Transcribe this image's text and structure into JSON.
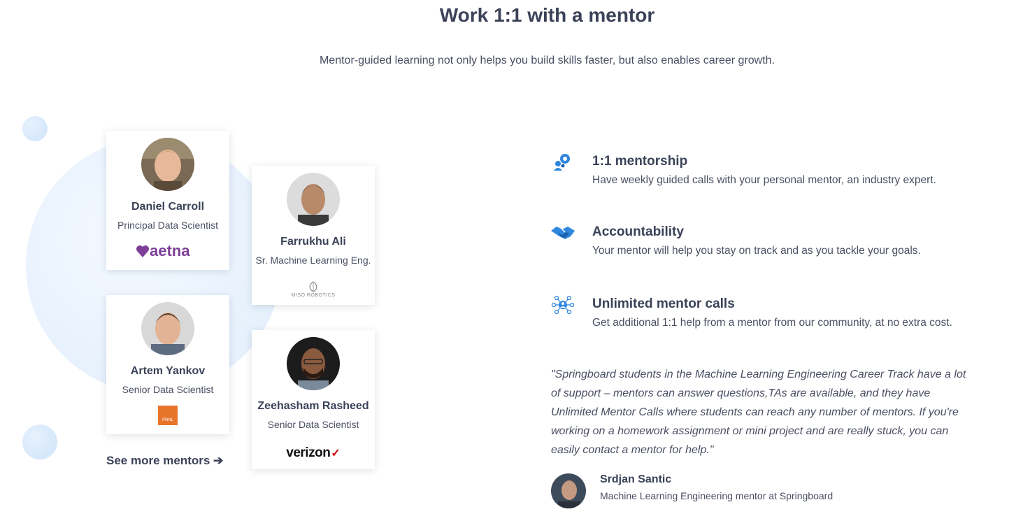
{
  "header": {
    "title": "Work 1:1 with a mentor",
    "subtitle": "Mentor-guided learning not only helps you build skills faster, but also enables career growth."
  },
  "mentors": [
    {
      "name": "Daniel Carroll",
      "role": "Principal Data Scientist",
      "company_logo": "aetna"
    },
    {
      "name": "Farrukhu Ali",
      "role": "Sr. Machine Learning Eng.",
      "company_logo": "MISO ROBOTICS"
    },
    {
      "name": "Artem Yankov",
      "role": "Senior Data Scientist",
      "company_logo": "PNNL"
    },
    {
      "name": "Zeehasham Rasheed",
      "role": "Senior Data Scientist",
      "company_logo": "verizon"
    }
  ],
  "see_more": "See more mentors ➔",
  "features": [
    {
      "icon": "mentorship-icon",
      "title": "1:1 mentorship",
      "text": "Have weekly guided calls with your personal mentor, an industry expert."
    },
    {
      "icon": "handshake-icon",
      "title": "Accountability",
      "text": "Your mentor will help you stay on track and as you tackle your goals."
    },
    {
      "icon": "network-icon",
      "title": "Unlimited mentor calls",
      "text": "Get additional 1:1 help from a mentor from our community, at no extra cost."
    }
  ],
  "testimonial": {
    "quote": "\"Springboard students in the Machine Learning Engineering Career Track have a lot of support – mentors can answer questions,TAs are available, and they have Unlimited Mentor Calls where students can reach any number of mentors. If you're working on a homework assignment or mini project and are really stuck, you can easily contact a mentor for help.\"",
    "author": "Srdjan Santic",
    "author_role": "Machine Learning Engineering mentor at Springboard"
  },
  "colors": {
    "accent_blue": "#2e86de",
    "aetna_purple": "#7d3f98",
    "pnnl_orange": "#e8742a",
    "verizon_red": "#cd040b"
  }
}
